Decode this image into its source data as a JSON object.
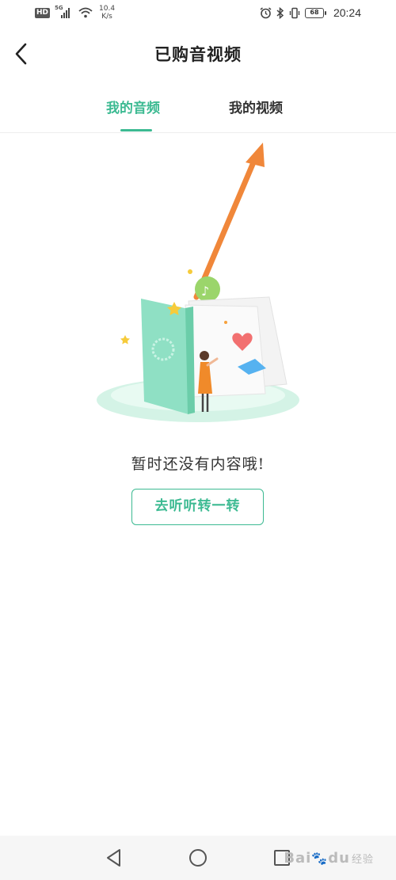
{
  "status_bar": {
    "hd_badge": "HD",
    "network": "5G",
    "speed_value": "10.4",
    "speed_unit": "K/s",
    "battery": "68",
    "time": "20:24"
  },
  "header": {
    "title": "已购音视频"
  },
  "tabs": [
    {
      "label": "我的音频",
      "active": true
    },
    {
      "label": "我的视频",
      "active": false
    }
  ],
  "empty_state": {
    "message": "暂时还没有内容哦!",
    "button_label": "去听听转一转"
  },
  "watermark": {
    "brand_a": "Bai",
    "brand_b": "du",
    "suffix": "经验"
  },
  "colors": {
    "accent": "#3cba92",
    "arrow": "#f0873a",
    "book": "#8fe0c4",
    "platform": "#c8f0e0"
  }
}
